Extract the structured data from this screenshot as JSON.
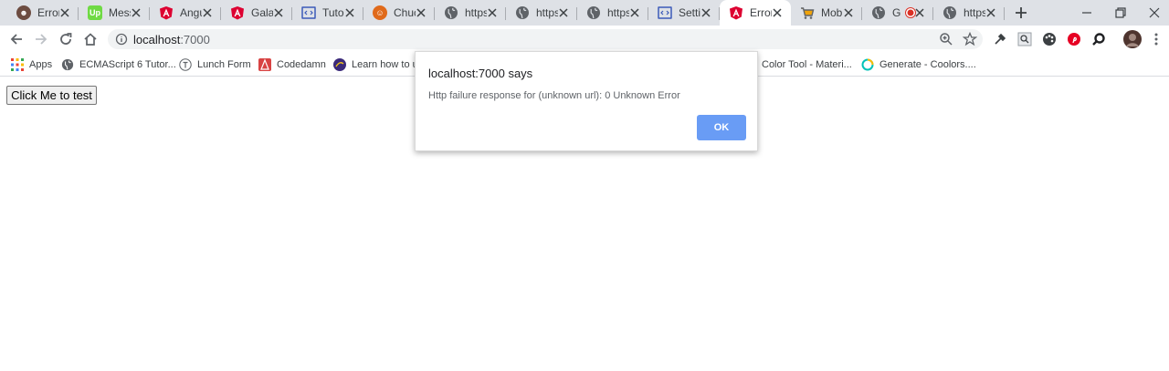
{
  "browser": {
    "tabs": [
      {
        "title": "Error",
        "icon": "bot-icon",
        "color": "#6d4c41"
      },
      {
        "title": "Mess",
        "icon": "upwork-icon",
        "color": "#6fda44"
      },
      {
        "title": "Angu",
        "icon": "angular-icon",
        "color": "#dd0031"
      },
      {
        "title": "Galax",
        "icon": "angular-icon",
        "color": "#dd0031"
      },
      {
        "title": "Tutor",
        "icon": "code-icon",
        "color": "#3c5ab9"
      },
      {
        "title": "Chuck",
        "icon": "chuck-icon",
        "color": "#e06a1b"
      },
      {
        "title": "https:",
        "icon": "globe-icon",
        "color": "#5f6368"
      },
      {
        "title": "https:",
        "icon": "globe-icon",
        "color": "#5f6368"
      },
      {
        "title": "https:",
        "icon": "globe-icon",
        "color": "#5f6368"
      },
      {
        "title": "Settin",
        "icon": "code-icon",
        "color": "#3c5ab9"
      },
      {
        "title": "Error",
        "icon": "angular-icon",
        "color": "#dd0031",
        "active": true
      },
      {
        "title": "Mobi",
        "icon": "cart-icon",
        "color": "#f0a30a"
      },
      {
        "title": "G",
        "icon": "globe-icon",
        "color": "#5f6368",
        "recording": true
      },
      {
        "title": "https:",
        "icon": "globe-icon",
        "color": "#5f6368"
      }
    ],
    "url": {
      "host": "localhost",
      "port": ":7000"
    }
  },
  "bookmarks": {
    "apps": "Apps",
    "b1": "ECMAScript 6 Tutor...",
    "b2": "Lunch Form",
    "b3": "Codedamn",
    "b4": "Learn how to us",
    "b5": "Color Tool - Materi...",
    "b6": "Generate - Coolors...."
  },
  "page": {
    "button_label": "Click Me to test"
  },
  "dialog": {
    "title": "localhost:7000 says",
    "message": "Http failure response for (unknown url): 0 Unknown Error",
    "ok_label": "OK",
    "ok_color": "#699cf5"
  }
}
